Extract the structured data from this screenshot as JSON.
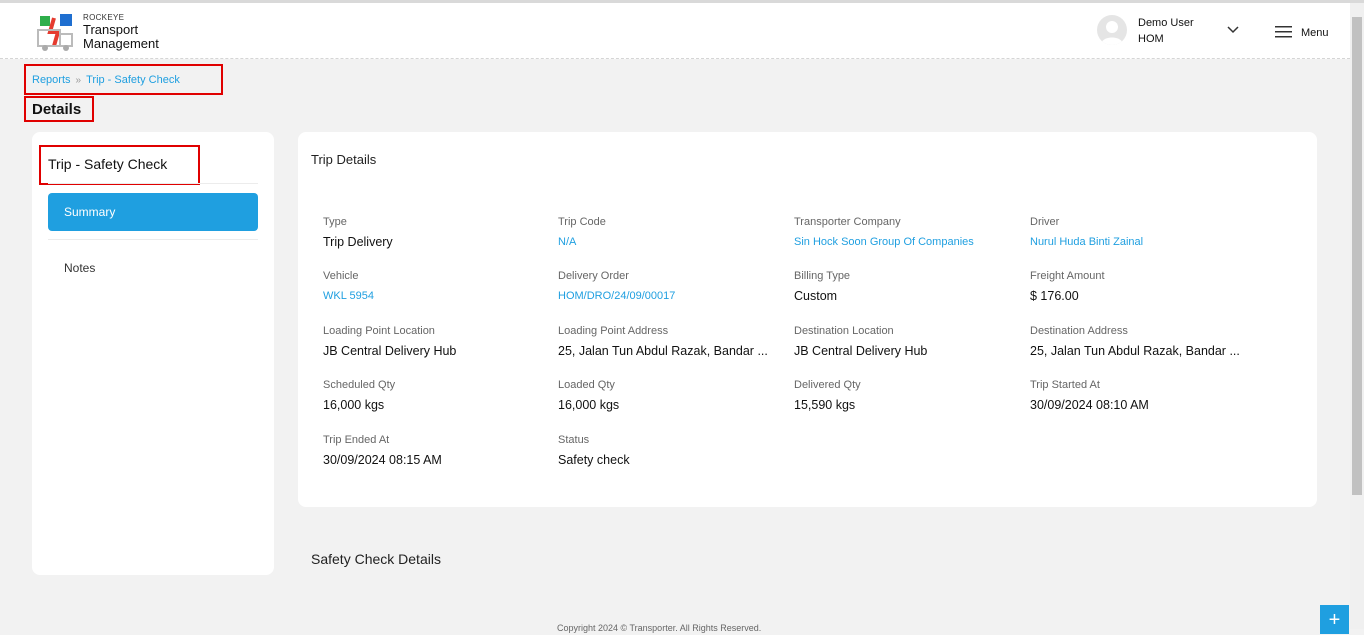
{
  "brand": {
    "small": "ROCKEYE",
    "line1": "Transport",
    "line2": "Management"
  },
  "user": {
    "name": "Demo User",
    "org": "HOM"
  },
  "menu": {
    "label": "Menu"
  },
  "breadcrumb": {
    "root": "Reports",
    "current": "Trip - Safety Check"
  },
  "page_title": "Details",
  "left_panel": {
    "title": "Trip - Safety Check",
    "summary": "Summary",
    "notes": "Notes"
  },
  "trip_details": {
    "title": "Trip Details",
    "fields": [
      {
        "label": "Type",
        "value": "Trip Delivery"
      },
      {
        "label": "Trip Code",
        "value": "N/A"
      },
      {
        "label": "Transporter Company",
        "value": "Sin Hock Soon Group Of Companies"
      },
      {
        "label": "Driver",
        "value": "Nurul Huda Binti Zainal"
      },
      {
        "label": "Vehicle",
        "value": "WKL 5954"
      },
      {
        "label": "Delivery Order",
        "value": "HOM/DRO/24/09/00017"
      },
      {
        "label": "Billing Type",
        "value": "Custom"
      },
      {
        "label": "Freight Amount",
        "value": "$ 176.00"
      },
      {
        "label": "Loading Point Location",
        "value": "JB Central Delivery Hub"
      },
      {
        "label": "Loading Point Address",
        "value": "25, Jalan Tun Abdul Razak, Bandar ..."
      },
      {
        "label": "Destination Location",
        "value": "JB Central Delivery Hub"
      },
      {
        "label": "Destination Address",
        "value": "25, Jalan Tun Abdul Razak, Bandar ..."
      },
      {
        "label": "Scheduled Qty",
        "value": "16,000 kgs"
      },
      {
        "label": "Loaded Qty",
        "value": "16,000 kgs"
      },
      {
        "label": "Delivered Qty",
        "value": "15,590 kgs"
      },
      {
        "label": "Trip Started At",
        "value": "30/09/2024 08:10 AM"
      },
      {
        "label": "Trip Ended At",
        "value": "30/09/2024 08:15 AM"
      },
      {
        "label": "Status",
        "value": "Safety check"
      }
    ]
  },
  "safety_check": {
    "title": "Safety Check Details"
  },
  "footer": {
    "text": "Copyright 2024 © Transporter. All Rights Reserved."
  },
  "fab": {
    "label": "+"
  },
  "colors": {
    "accent": "#1f9fe0",
    "highlight": "#e00000"
  }
}
